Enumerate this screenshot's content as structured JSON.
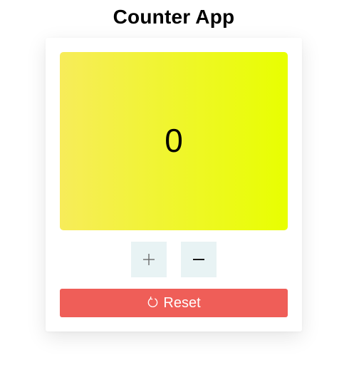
{
  "app": {
    "title": "Counter App"
  },
  "counter": {
    "value": "0",
    "gradient_start": "#f7ec5a",
    "gradient_end": "#e8ff00"
  },
  "controls": {
    "increment_icon": "plus-icon",
    "decrement_icon": "minus-icon",
    "button_bg": "#e8f3f4"
  },
  "reset": {
    "label": "Reset",
    "icon": "refresh-icon",
    "color": "#ef5e58"
  }
}
